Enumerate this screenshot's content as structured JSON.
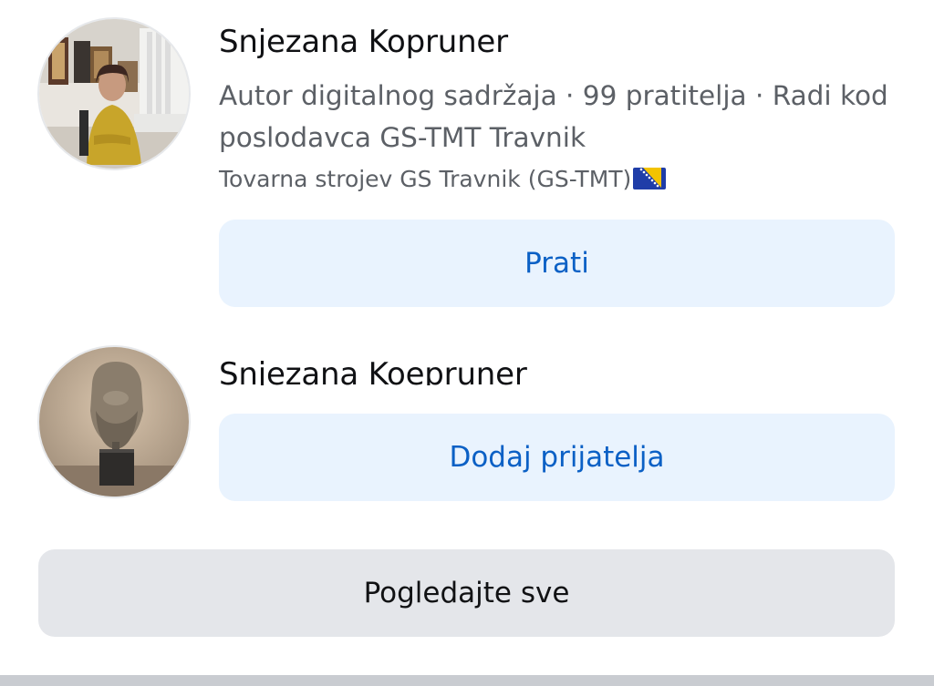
{
  "results": [
    {
      "name": "Snjezana Kopruner",
      "subtitle": "Autor digitalnog sadržaja · 99 pratitelja · Radi kod poslodavca GS-TMT Travnik",
      "workplace": "Tovarna strojev GS Travnik (GS-TMT)",
      "workplace_flag_icon": "bosnia-flag-icon",
      "action_label": "Prati"
    },
    {
      "name": "Snjezana Koepruner",
      "action_label": "Dodaj prijatelja"
    }
  ],
  "footer": {
    "see_all_label": "Pogledajte sve"
  },
  "colors": {
    "primary_button_bg": "#e9f3fe",
    "primary_button_text": "#0b60c5",
    "secondary_button_bg": "#e4e6ea",
    "name_text": "#101114",
    "secondary_text": "#5c6066"
  }
}
